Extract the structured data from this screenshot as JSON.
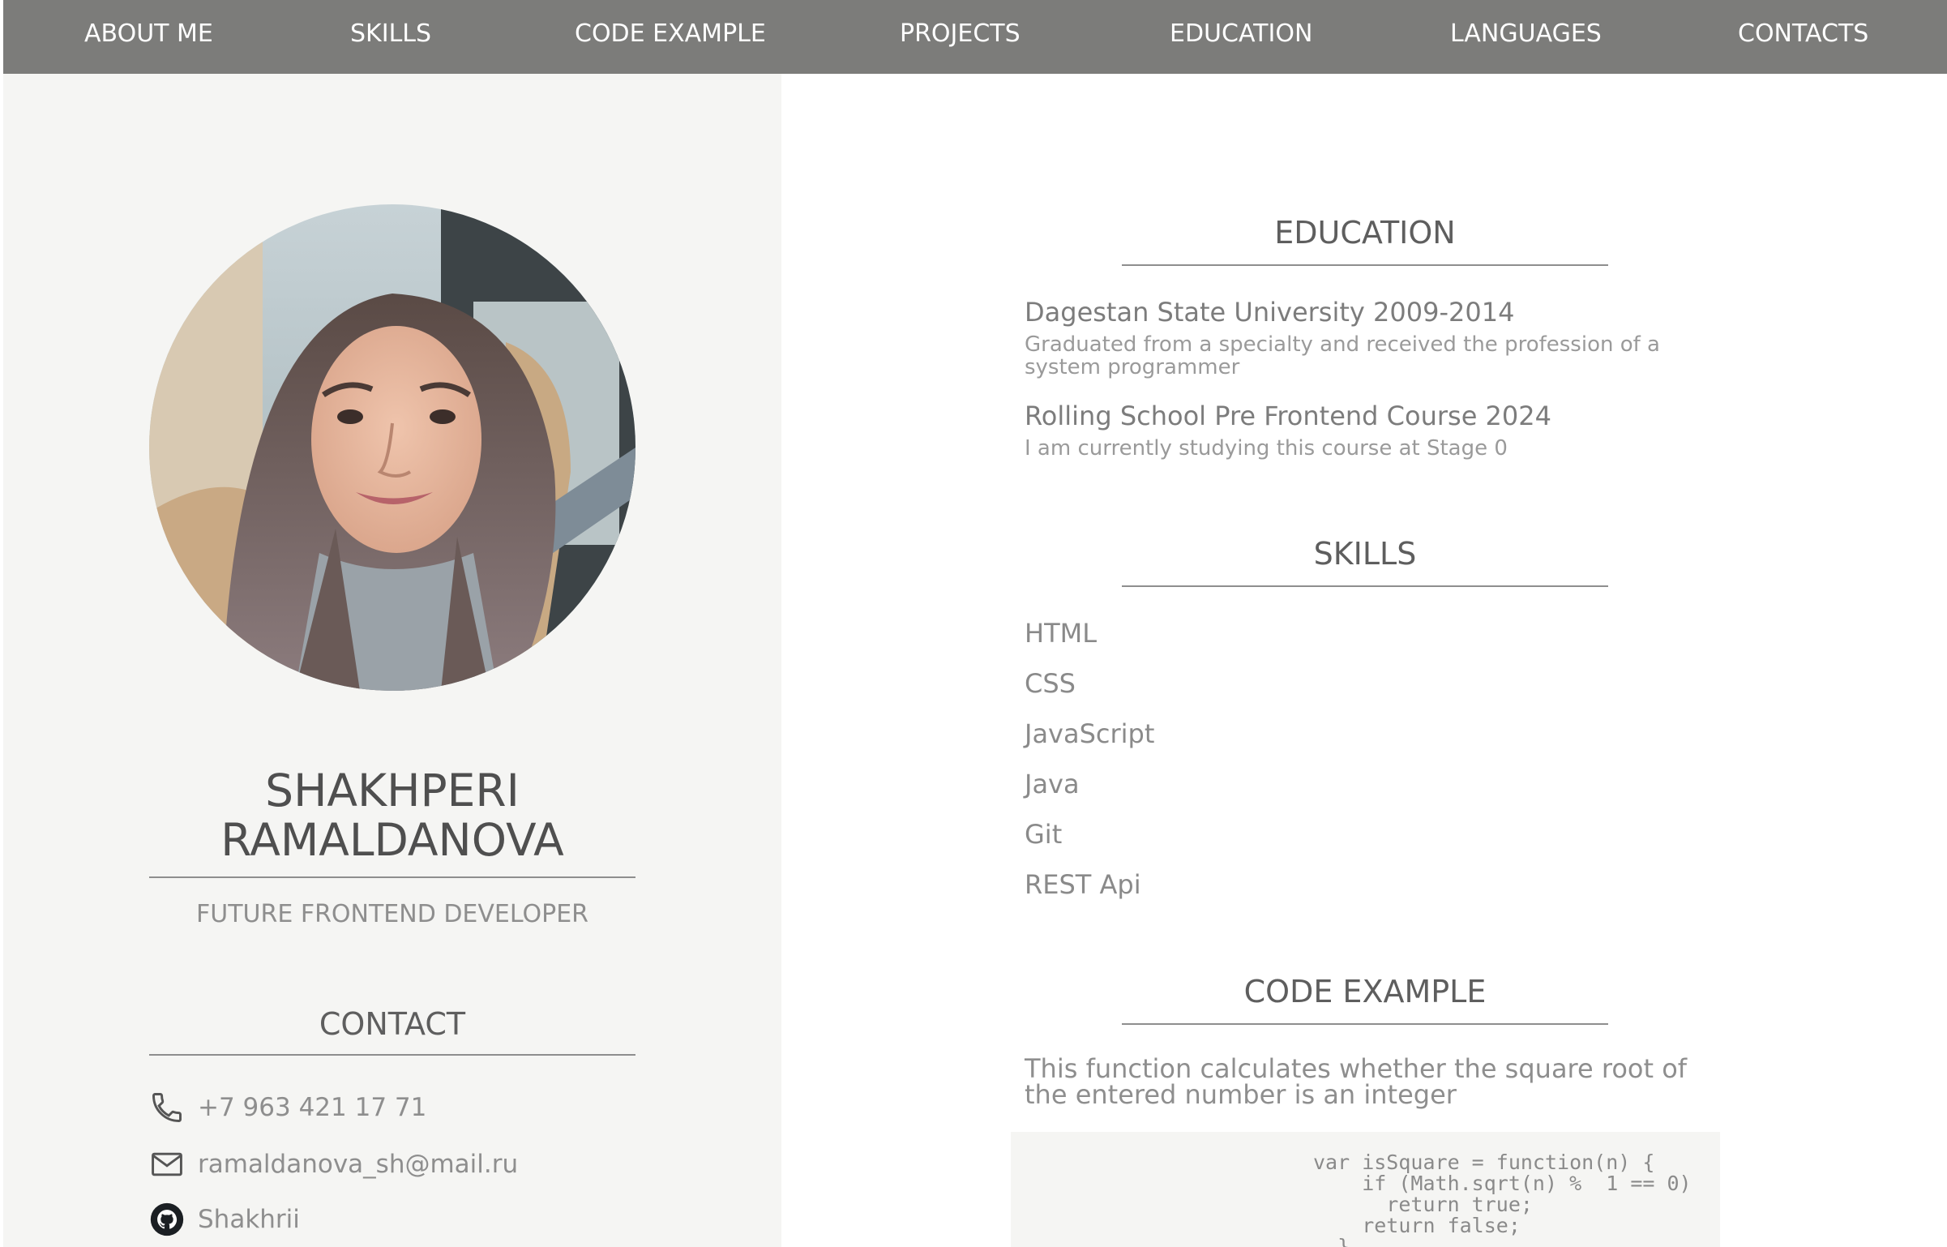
{
  "nav": {
    "items": [
      {
        "label": "ABOUT ME"
      },
      {
        "label": "SKILLS"
      },
      {
        "label": "CODE EXAMPLE"
      },
      {
        "label": "PROJECTS"
      },
      {
        "label": "EDUCATION"
      },
      {
        "label": "LANGUAGES"
      },
      {
        "label": "CONTACTS"
      }
    ]
  },
  "profile": {
    "name_line1": "SHAKHPERI",
    "name_line2": "RAMALDANOVA",
    "subtitle": "FUTURE FRONTEND DEVELOPER",
    "photo_icon": "profile-photo"
  },
  "contact": {
    "title": "CONTACT",
    "phone": "+7 963 421 17 71",
    "email": "ramaldanova_sh@mail.ru",
    "github": "Shakhrii"
  },
  "education": {
    "title": "EDUCATION",
    "items": [
      {
        "name": "Dagestan State University 2009-2014",
        "desc": "Graduated from a specialty and received the profession of a system programmer"
      },
      {
        "name": "Rolling School Pre Frontend Course 2024",
        "desc": "I am currently studying this course at Stage 0"
      }
    ]
  },
  "skills": {
    "title": "SKILLS",
    "items": [
      "HTML",
      "CSS",
      "JavaScript",
      "Java",
      "Git",
      "REST Api"
    ]
  },
  "code_example": {
    "title": "CODE EXAMPLE",
    "description": "This function calculates whether the square root of the entered number is an integer",
    "code": "var isSquare = function(n) {\n    if (Math.sqrt(n) %  1 == 0)\n      return true;\n    return false;\n  }"
  },
  "colors": {
    "nav_bg": "#7c7c7a",
    "sidebar_bg": "#f5f5f3",
    "heading": "#5e5e5e",
    "muted_text": "#8e8e8e"
  }
}
